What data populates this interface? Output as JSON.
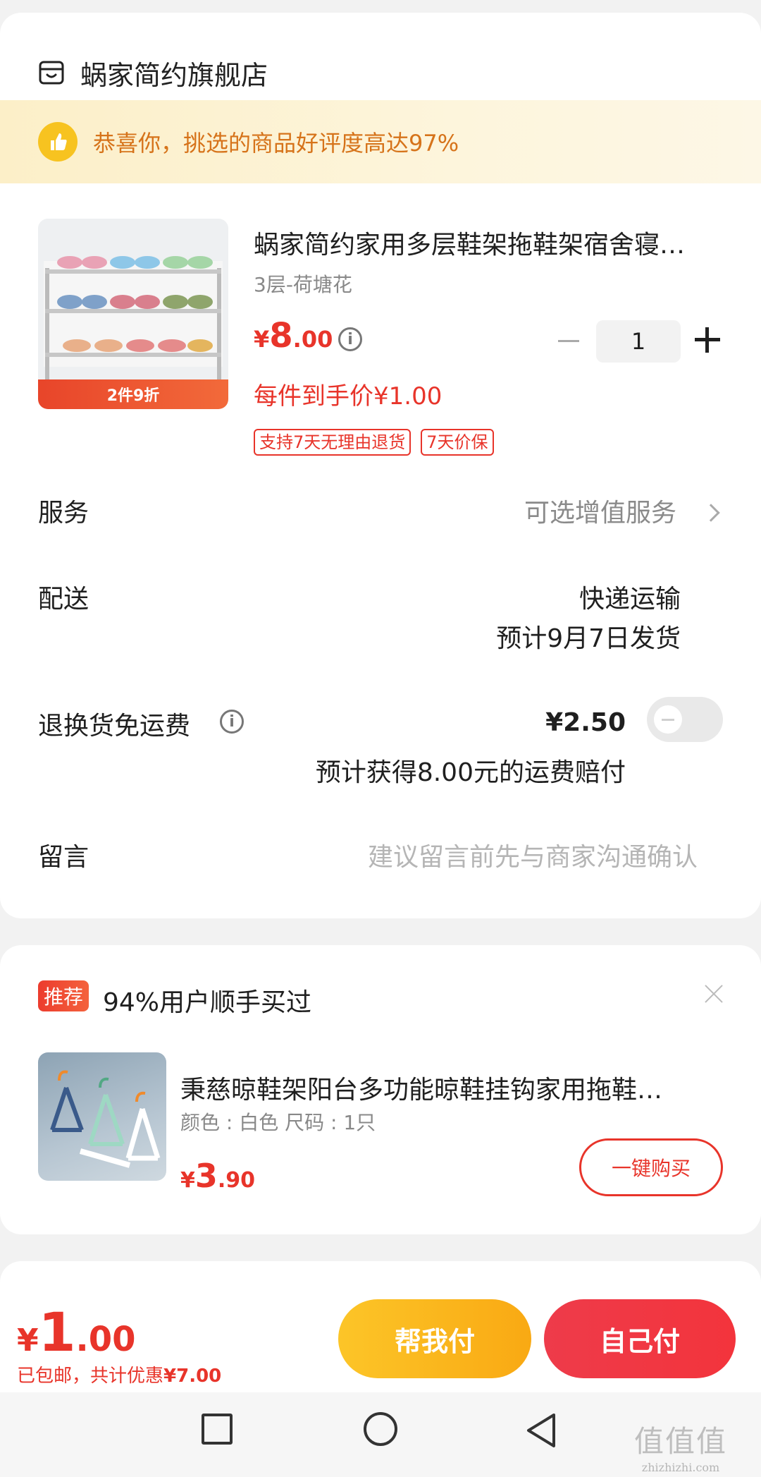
{
  "shop": {
    "name": "蜗家简约旗舰店",
    "icon": "store-icon"
  },
  "congrats": {
    "text": "恭喜你，挑选的商品好评度高达97%",
    "icon": "thumbs-up-icon"
  },
  "product": {
    "image_badge": "2件9折",
    "title": "蜗家简约家用多层鞋架拖鞋架宿舍寝…",
    "spec": "3层-荷塘花",
    "price_currency": "¥",
    "price_int": "8",
    "price_dec": ".00",
    "final_price": "每件到手价¥1.00",
    "tags": [
      "支持7天无理由退货",
      "7天价保"
    ],
    "quantity": "1"
  },
  "rows": {
    "service": {
      "label": "服务",
      "value": "可选增值服务"
    },
    "delivery": {
      "label": "配送",
      "method": "快递运输",
      "eta": "预计9月7日发货"
    },
    "return_freight": {
      "label": "退换货免运费",
      "price": "¥2.50",
      "note": "预计获得8.00元的运费赔付",
      "toggle_on": false
    },
    "message": {
      "label": "留言",
      "placeholder": "建议留言前先与商家沟通确认"
    }
  },
  "recommend": {
    "badge": "推荐",
    "title": "94%用户顺手买过",
    "item": {
      "name": "秉慈晾鞋架阳台多功能晾鞋挂钩家用拖鞋…",
      "spec": "颜色 : 白色   尺码 : 1只",
      "price_currency": "¥",
      "price_int": "3",
      "price_dec": ".90",
      "buy_label": "一键购买"
    }
  },
  "checkout": {
    "currency": "¥",
    "total_int": "1",
    "total_dec": ".00",
    "note_prefix": "已包邮，共计优惠",
    "discount": "¥7.00",
    "help_pay_label": "帮我付",
    "self_pay_label": "自己付"
  },
  "nav": {
    "icons": [
      "recent-apps-icon",
      "home-icon",
      "back-icon"
    ]
  },
  "watermark": {
    "big": "值值值",
    "small": "zhizhizhi.com"
  },
  "colors": {
    "accent": "#e8342a",
    "gold": "#f9b41a",
    "congrats_text": "#d6731a"
  }
}
